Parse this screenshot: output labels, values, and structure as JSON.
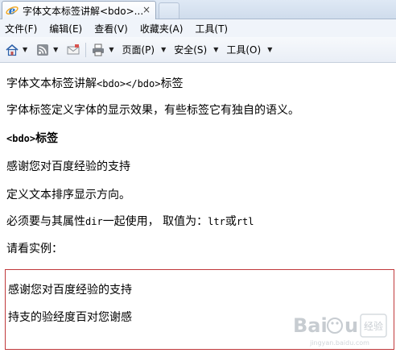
{
  "tab": {
    "title": "字体文本标签讲解<bdo>...",
    "close_glyph": "×"
  },
  "menu": [
    "文件(F)",
    "编辑(E)",
    "查看(V)",
    "收藏夹(A)",
    "工具(T)"
  ],
  "commandbar": {
    "page_label": "页面(P)",
    "safety_label": "安全(S)",
    "tools_label": "工具(O)"
  },
  "content": {
    "title_prefix": "字体文本标签讲解",
    "title_code": "<bdo></bdo>",
    "title_suffix": "标签",
    "intro": "字体标签定义字体的显示效果，有些标签它有独自的语义。",
    "heading_code": "<bdo>",
    "heading_suffix": "标签",
    "p1": "感谢您对百度经验的支持",
    "p2": "定义文本排序显示方向。",
    "p3_prefix": "必须要与其属性",
    "p3_code1": "dir",
    "p3_middle": "一起使用，  取值为：",
    "p3_code2": "ltr",
    "p3_or": "或",
    "p3_code3": "rtl",
    "p4": "请看实例："
  },
  "example": {
    "normal": "感谢您对百度经验的支持",
    "reversed": "持支的验经度百对您谢感"
  },
  "colors": {
    "example_border": "#c0393b",
    "ie_blue": "#1e6fc8",
    "ie_orange": "#f2a51a"
  }
}
